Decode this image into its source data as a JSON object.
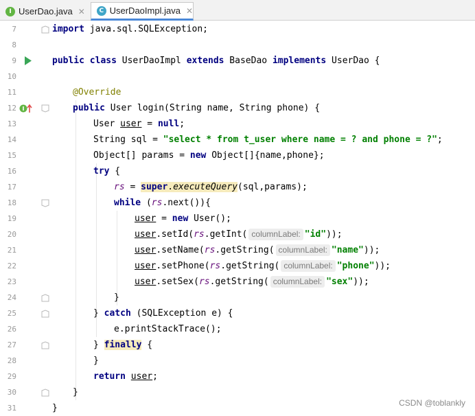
{
  "tabs": [
    {
      "badge": "I",
      "label": "UserDao.java",
      "close": "✕"
    },
    {
      "badge": "C",
      "label": "UserDaoImpl.java",
      "close": "✕"
    }
  ],
  "line_numbers": [
    "7",
    "8",
    "9",
    "10",
    "11",
    "12",
    "13",
    "14",
    "15",
    "16",
    "17",
    "18",
    "19",
    "20",
    "21",
    "22",
    "23",
    "24",
    "25",
    "26",
    "27",
    "28",
    "29",
    "30",
    "31"
  ],
  "code": {
    "l7": {
      "kw": "import",
      "rest": " java.sql.SQLException;"
    },
    "l9": {
      "kw1": "public",
      "kw2": "class",
      "name": " UserDaoImpl ",
      "kw3": "extends",
      "base": " BaseDao ",
      "kw4": "implements",
      "iface": " UserDao {"
    },
    "l11": {
      "annotation": "@Override"
    },
    "l12": {
      "kw": "public",
      "rest": " User login(String name, String phone) {"
    },
    "l13": {
      "type": "User ",
      "var": "user",
      "eq": " = ",
      "kw": "null",
      "end": ";"
    },
    "l14": {
      "pre": "String sql = ",
      "str": "\"select * from t_user where name = ? and phone = ?\"",
      "end": ";"
    },
    "l15": {
      "pre": "Object[] params = ",
      "kw": "new",
      "rest": " Object[]{name,phone};"
    },
    "l16": {
      "kw": "try",
      "rest": " {"
    },
    "l17": {
      "field": "rs",
      "eq": " = ",
      "super": "super",
      "dot": ".",
      "method": "executeQuery",
      "rest": "(sql,params);"
    },
    "l18": {
      "kw": "while",
      "pre": " (",
      "field": "rs",
      "rest": ".next()){"
    },
    "l19": {
      "var": "user",
      "eq": " = ",
      "kw": "new",
      "rest": " User();"
    },
    "l20": {
      "var": "user",
      "call": ".setId(",
      "field": "rs",
      "get": ".getInt(",
      "hint": "columnLabel:",
      "str": "\"id\"",
      "end": "));"
    },
    "l21": {
      "var": "user",
      "call": ".setName(",
      "field": "rs",
      "get": ".getString(",
      "hint": "columnLabel:",
      "str": "\"name\"",
      "end": "));"
    },
    "l22": {
      "var": "user",
      "call": ".setPhone(",
      "field": "rs",
      "get": ".getString(",
      "hint": "columnLabel:",
      "str": "\"phone\"",
      "end": "));"
    },
    "l23": {
      "var": "user",
      "call": ".setSex(",
      "field": "rs",
      "get": ".getString(",
      "hint": "columnLabel:",
      "str": "\"sex\"",
      "end": "));"
    },
    "l24": {
      "text": "}"
    },
    "l25": {
      "pre": "} ",
      "kw": "catch",
      "rest": " (SQLException e) {"
    },
    "l26": {
      "text": "e.printStackTrace();"
    },
    "l27": {
      "pre": "} ",
      "kw": "finally",
      "rest": " {"
    },
    "l28": {
      "text": "}"
    },
    "l29": {
      "kw": "return",
      "sp": " ",
      "var": "user",
      "end": ";"
    },
    "l30": {
      "text": "}"
    },
    "l31": {
      "text": "}"
    }
  },
  "watermark": "CSDN @toblankly",
  "colors": {
    "keyword": "#000080",
    "string": "#008000",
    "annotation": "#808000",
    "field": "#660e7a",
    "tab_active_underline": "#4a88d8"
  }
}
